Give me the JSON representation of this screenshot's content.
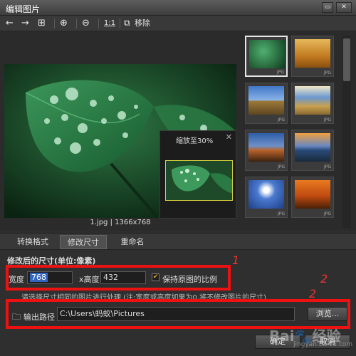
{
  "window": {
    "title": "编辑图片",
    "min": "▭",
    "close": "✕"
  },
  "toolbar": {
    "back_icon": "←",
    "forward_icon": "→",
    "add_icon": "⊞",
    "zoom_in_icon": "⊕",
    "zoom_out_icon": "⊖",
    "actual_size_label": "1:1",
    "remove_label": "移除"
  },
  "preview": {
    "caption": "1.jpg | 1366x768",
    "zoom_label": "缩放至30%",
    "zoom_close": "✕"
  },
  "thumbnails": [
    {
      "ext": "JPG",
      "selected": true
    },
    {
      "ext": "JPG",
      "selected": false
    },
    {
      "ext": "JPG",
      "selected": false
    },
    {
      "ext": "JPG",
      "selected": false
    },
    {
      "ext": "JPG",
      "selected": false
    },
    {
      "ext": "JPG",
      "selected": false
    },
    {
      "ext": "JPG",
      "selected": false
    },
    {
      "ext": "JPG",
      "selected": false
    }
  ],
  "tabs": [
    {
      "label": "转换格式"
    },
    {
      "label": "修改尺寸"
    },
    {
      "label": "重命名"
    }
  ],
  "resize": {
    "section_title": "修改后的尺寸(单位:像素)",
    "width_label": "宽度",
    "width_value": "768",
    "height_label": "x高度",
    "height_value": "432",
    "keep_ratio_label": "保持原图的比例",
    "note": "请选择尺寸相同的图片进行处理 (注:宽度或高度如果为0,将不修改图片的尺寸)"
  },
  "output": {
    "label": "输出路径",
    "path": "C:\\Users\\蚂蚁\\Pictures",
    "browse": "浏览..."
  },
  "footer": {
    "ok": "确定",
    "cancel": "取消"
  },
  "annotations": {
    "m1": "1",
    "m2": "2",
    "m3": "2"
  },
  "watermark": {
    "main": "Bai🐾经验",
    "sub": "jingyan.baidu.com"
  }
}
